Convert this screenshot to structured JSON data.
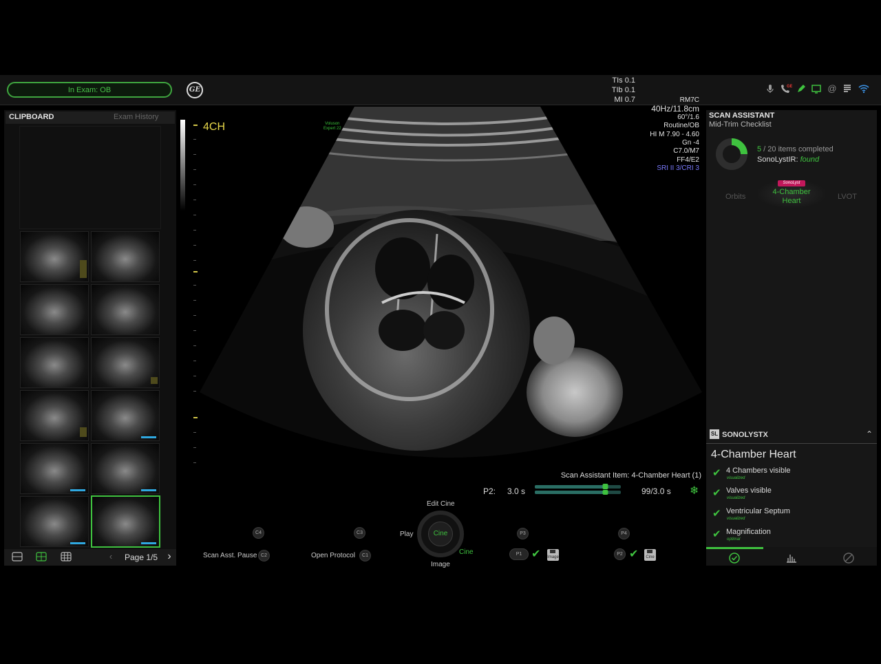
{
  "status": {
    "exam": "In Exam: OB"
  },
  "logo": "GE",
  "acoustic": {
    "tis": "TIs 0.1",
    "tib": "TIb 0.1",
    "mi": "MI 0.7"
  },
  "top_icons": [
    "microphone-icon",
    "phone-ge-icon",
    "pen-icon",
    "monitor-icon",
    "at-icon",
    "document-icon",
    "wifi-icon"
  ],
  "clipboard": {
    "title": "CLIPBOARD",
    "exam_history": "Exam History",
    "page_label": "Page 1/5",
    "thumbnails": 12,
    "selected_index": 11
  },
  "image": {
    "view_label": "4CH",
    "brand": [
      "Voluson",
      "Expert 22"
    ],
    "params": {
      "probe": "RM7C",
      "freq_depth": "40Hz/11.8cm",
      "angle": "60°/1.6",
      "preset": "Routine/OB",
      "harmonic": "HI M  7.90 - 4.60",
      "gain": "Gn  -4",
      "c": "C7.0/M7",
      "ff": "FF4/E2",
      "sri": "SRI II 3/CRI 3"
    }
  },
  "cine": {
    "scan_item": "Scan Assistant Item: 4-Chamber Heart (1)",
    "p2_label": "P2:",
    "p2_value": "3.0 s",
    "frames": "99/3.0 s",
    "progress": 0.82
  },
  "controls": {
    "c4": "C4",
    "c3": "C3",
    "c2": "C2",
    "c1": "C1",
    "p3": "P3",
    "p4": "P4",
    "p1": "P1",
    "p2": "P2",
    "scan_pause": "Scan Asst. Pause",
    "open_protocol": "Open Protocol",
    "edit_cine": "Edit Cine",
    "play": "Play",
    "cine_center": "Cine",
    "cine_side": "Cine",
    "image": "Image",
    "save_image": "Image",
    "save_cine": "Cine"
  },
  "scan_assistant": {
    "title": "SCAN ASSISTANT",
    "subtitle": "Mid-Trim Checklist",
    "completed": 5,
    "total": "20",
    "items_text": " items completed",
    "sonolyst_label": "SonoLystIR:",
    "sonolyst_status": "found",
    "carousel": {
      "left": "Orbits",
      "center": "4-Chamber\nHeart",
      "right": "LVOT",
      "badge": "SonoLyst"
    }
  },
  "sonolystx": {
    "title": "SONOLYSTX",
    "heading": "4-Chamber Heart",
    "items": [
      {
        "label": "4 Chambers visible",
        "status": "visualized"
      },
      {
        "label": "Valves visible",
        "status": "visualized"
      },
      {
        "label": "Ventricular Septum",
        "status": "visualized"
      },
      {
        "label": "Magnification",
        "status": "optimal"
      }
    ]
  },
  "colors": {
    "accent": "#3fc23f",
    "background": "#000000",
    "panel": "#171717",
    "badge": "#c2185b",
    "sri": "#7b7bff",
    "view_label": "#e8d84a"
  }
}
